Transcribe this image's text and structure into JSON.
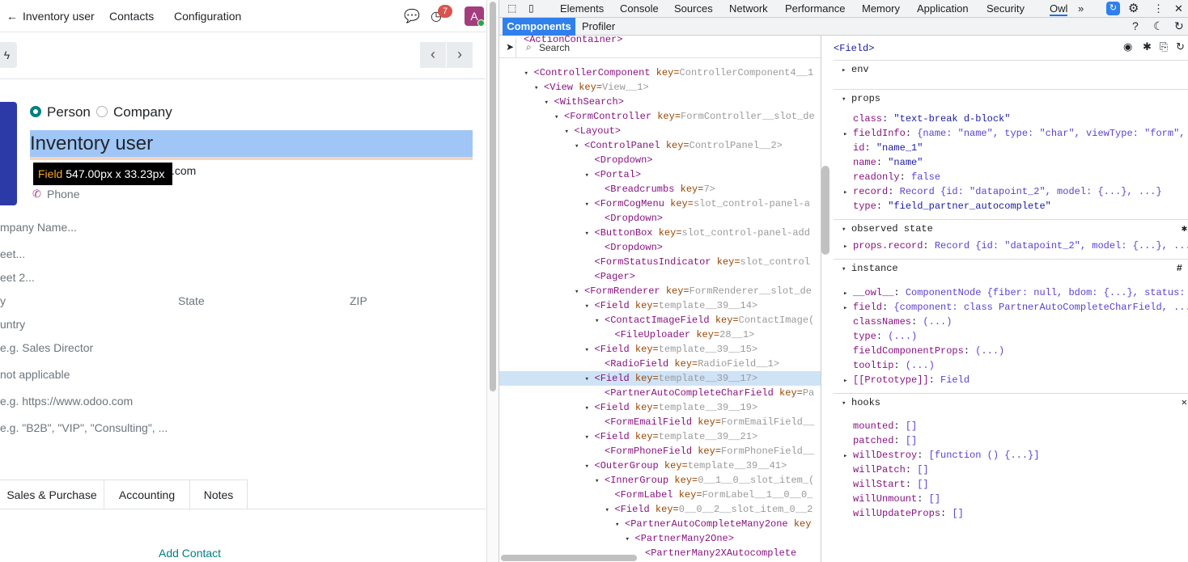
{
  "odoo": {
    "nav": {
      "back_label": "Inventory user",
      "contacts": "Contacts",
      "configuration": "Configuration",
      "activity_count": "7",
      "avatar_letter": "A"
    },
    "partner_type": {
      "person": "Person",
      "company": "Company"
    },
    "name": "Inventory user",
    "tooltip": {
      "label": "Field",
      "size": "547.00px x 33.23px"
    },
    "email_suffix": ".com",
    "phone_placeholder": "Phone",
    "fields": {
      "company_name": "mpany Name...",
      "street": "eet...",
      "street2": "eet 2...",
      "city_label": "y",
      "state": "State",
      "zip": "ZIP",
      "country": "untry",
      "job": "e.g. Sales Director",
      "vat": "not applicable",
      "website": "e.g. https://www.odoo.com",
      "tags": "e.g. \"B2B\", \"VIP\", \"Consulting\", ..."
    },
    "tabs": [
      "Sales & Purchase",
      "Accounting",
      "Notes"
    ],
    "add_contact": "Add Contact"
  },
  "devtools": {
    "tabs": [
      "Elements",
      "Console",
      "Sources",
      "Network",
      "Performance",
      "Memory",
      "Application",
      "Security",
      "Owl"
    ],
    "subtabs": {
      "components": "Components",
      "profiler": "Profiler"
    },
    "search_placeholder": "Search",
    "tree": [
      {
        "indent": 0,
        "tri": "",
        "tag": "<ActionContainer>",
        "key": "",
        "val": ""
      },
      {
        "indent": 1,
        "tri": "▾",
        "tag": "<ControllerComponent",
        "key": "key=",
        "val": "ControllerComponent4__1"
      },
      {
        "indent": 2,
        "tri": "▾",
        "tag": "<View",
        "key": "key=",
        "val": "View__1>"
      },
      {
        "indent": 3,
        "tri": "▾",
        "tag": "<WithSearch>",
        "key": "",
        "val": ""
      },
      {
        "indent": 4,
        "tri": "▾",
        "tag": "<FormController",
        "key": "key=",
        "val": "FormController__slot_de"
      },
      {
        "indent": 5,
        "tri": "▾",
        "tag": "<Layout>",
        "key": "",
        "val": ""
      },
      {
        "indent": 6,
        "tri": "▾",
        "tag": "<ControlPanel",
        "key": "key=",
        "val": "ControlPanel__2>"
      },
      {
        "indent": 7,
        "tri": "",
        "tag": "<Dropdown>",
        "key": "",
        "val": ""
      },
      {
        "indent": 7,
        "tri": "▾",
        "tag": "<Portal>",
        "key": "",
        "val": ""
      },
      {
        "indent": 8,
        "tri": "",
        "tag": "<Breadcrumbs",
        "key": "key=",
        "val": "7>"
      },
      {
        "indent": 7,
        "tri": "▾",
        "tag": "<FormCogMenu",
        "key": "key=",
        "val": "slot_control-panel-a"
      },
      {
        "indent": 8,
        "tri": "",
        "tag": "<Dropdown>",
        "key": "",
        "val": ""
      },
      {
        "indent": 7,
        "tri": "▾",
        "tag": "<ButtonBox",
        "key": "key=",
        "val": "slot_control-panel-add"
      },
      {
        "indent": 8,
        "tri": "",
        "tag": "<Dropdown>",
        "key": "",
        "val": ""
      },
      {
        "indent": 7,
        "tri": "",
        "tag": "<FormStatusIndicator",
        "key": "key=",
        "val": "slot_control"
      },
      {
        "indent": 7,
        "tri": "",
        "tag": "<Pager>",
        "key": "",
        "val": ""
      },
      {
        "indent": 6,
        "tri": "▾",
        "tag": "<FormRenderer",
        "key": "key=",
        "val": "FormRenderer__slot_de"
      },
      {
        "indent": 7,
        "tri": "▾",
        "tag": "<Field",
        "key": "key=",
        "val": "template__39__14>"
      },
      {
        "indent": 8,
        "tri": "▾",
        "tag": "<ContactImageField",
        "key": "key=",
        "val": "ContactImage("
      },
      {
        "indent": 9,
        "tri": "",
        "tag": "<FileUploader",
        "key": "key=",
        "val": "28__1>"
      },
      {
        "indent": 7,
        "tri": "▾",
        "tag": "<Field",
        "key": "key=",
        "val": "template__39__15>"
      },
      {
        "indent": 8,
        "tri": "",
        "tag": "<RadioField",
        "key": "key=",
        "val": "RadioField__1>"
      },
      {
        "indent": 7,
        "tri": "▾",
        "tag": "<Field",
        "key": "key=",
        "val": "template__39__17>",
        "selected": true
      },
      {
        "indent": 8,
        "tri": "",
        "tag": "<PartnerAutoCompleteCharField",
        "key": "key=",
        "val": "Pa"
      },
      {
        "indent": 7,
        "tri": "▾",
        "tag": "<Field",
        "key": "key=",
        "val": "template__39__19>"
      },
      {
        "indent": 8,
        "tri": "",
        "tag": "<FormEmailField",
        "key": "key=",
        "val": "FormEmailField__"
      },
      {
        "indent": 7,
        "tri": "▾",
        "tag": "<Field",
        "key": "key=",
        "val": "template__39__21>"
      },
      {
        "indent": 8,
        "tri": "",
        "tag": "<FormPhoneField",
        "key": "key=",
        "val": "FormPhoneField__"
      },
      {
        "indent": 7,
        "tri": "▾",
        "tag": "<OuterGroup",
        "key": "key=",
        "val": "template__39__41>"
      },
      {
        "indent": 8,
        "tri": "▾",
        "tag": "<InnerGroup",
        "key": "key=",
        "val": "0__1__0__slot_item_("
      },
      {
        "indent": 9,
        "tri": "",
        "tag": "<FormLabel",
        "key": "key=",
        "val": "FormLabel__1__0__0_"
      },
      {
        "indent": 9,
        "tri": "▾",
        "tag": "<Field",
        "key": "key=",
        "val": "0__0__2__slot_item_0__2"
      },
      {
        "indent": 10,
        "tri": "▾",
        "tag": "<PartnerAutoCompleteMany2one",
        "key": "key",
        "val": ""
      },
      {
        "indent": 11,
        "tri": "▾",
        "tag": "<PartnerMany2One>",
        "key": "",
        "val": ""
      },
      {
        "indent": 12,
        "tri": "",
        "tag": "<PartnerMany2XAutocomplete",
        "key": "",
        "val": ""
      }
    ],
    "details": {
      "title": "<Field>",
      "env": "env",
      "props_header": "props",
      "props": [
        {
          "tri": "",
          "k": "class",
          "v": "\"text-break d-block\"",
          "t": "s"
        },
        {
          "tri": "▸",
          "k": "fieldInfo",
          "v": "{name: \"name\", type: \"char\", viewType: \"form\",",
          "t": "o"
        },
        {
          "tri": "",
          "k": "id",
          "v": "\"name_1\"",
          "t": "s"
        },
        {
          "tri": "",
          "k": "name",
          "v": "\"name\"",
          "t": "s"
        },
        {
          "tri": "",
          "k": "readonly",
          "v": "false",
          "t": "o"
        },
        {
          "tri": "▸",
          "k": "record",
          "v": "Record {id: \"datapoint_2\", model: {...}, ...}",
          "t": "o"
        },
        {
          "tri": "",
          "k": "type",
          "v": "\"field_partner_autocomplete\"",
          "t": "s"
        }
      ],
      "observed_header": "observed state",
      "observed": [
        {
          "tri": "▸",
          "k": "props.record",
          "v": "Record {id: \"datapoint_2\", model: {...}, ...",
          "t": "o"
        }
      ],
      "instance_header": "instance",
      "instance": [
        {
          "tri": "▸",
          "k": "__owl__",
          "v": "ComponentNode {fiber: null, bdom: {...}, status:",
          "t": "o"
        },
        {
          "tri": "▸",
          "k": "field",
          "v": "{component: class PartnerAutoCompleteCharField, ...",
          "t": "o"
        },
        {
          "tri": "",
          "k": "classNames",
          "v": "(...)",
          "t": "o"
        },
        {
          "tri": "",
          "k": "type",
          "v": "(...)",
          "t": "o"
        },
        {
          "tri": "",
          "k": "fieldComponentProps",
          "v": "(...)",
          "t": "o"
        },
        {
          "tri": "",
          "k": "tooltip",
          "v": "(...)",
          "t": "o"
        },
        {
          "tri": "▸",
          "k": "[[Prototype]]",
          "v": "Field",
          "t": "o"
        }
      ],
      "hooks_header": "hooks",
      "hooks": [
        {
          "tri": "",
          "k": "mounted",
          "v": "[]",
          "t": "o"
        },
        {
          "tri": "",
          "k": "patched",
          "v": "[]",
          "t": "o"
        },
        {
          "tri": "▸",
          "k": "willDestroy",
          "v": "[function () {...}]",
          "t": "o"
        },
        {
          "tri": "",
          "k": "willPatch",
          "v": "[]",
          "t": "o"
        },
        {
          "tri": "",
          "k": "willStart",
          "v": "[]",
          "t": "o"
        },
        {
          "tri": "",
          "k": "willUnmount",
          "v": "[]",
          "t": "o"
        },
        {
          "tri": "",
          "k": "willUpdateProps",
          "v": "[]",
          "t": "o"
        }
      ]
    }
  },
  "colors": {
    "accent": "#2f80ed",
    "odoo_purple": "#a43d7d",
    "teal": "#017e84"
  }
}
